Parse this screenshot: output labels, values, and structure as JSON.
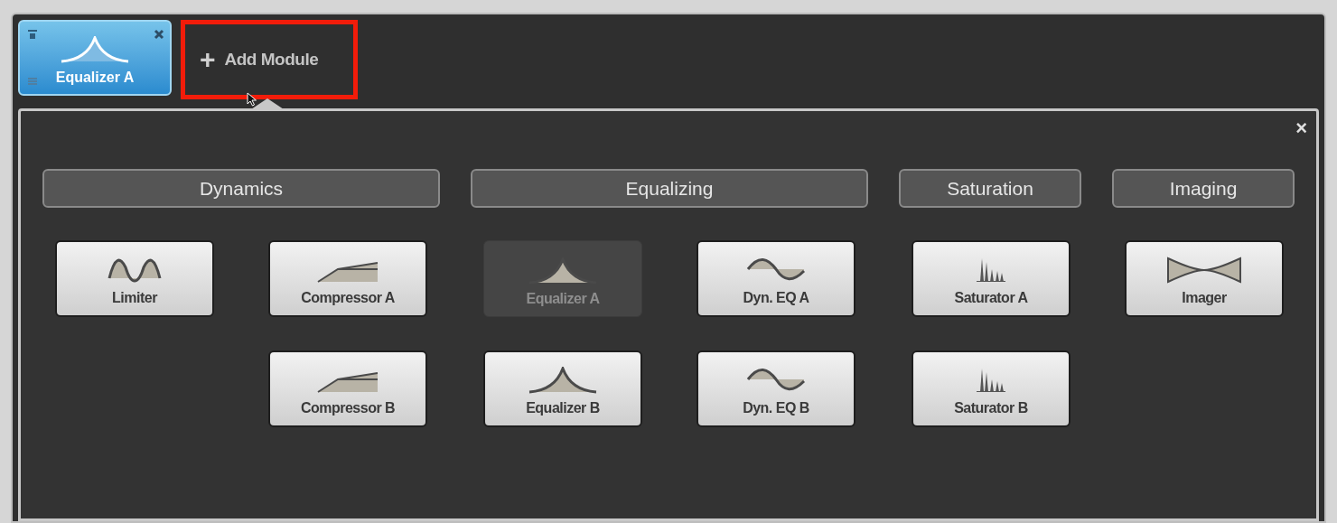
{
  "module_tabs": [
    {
      "label": "Equalizer A",
      "kind": "peak",
      "selected": true
    }
  ],
  "add_module": {
    "label": "Add Module",
    "prefix": "+",
    "highlighted": true
  },
  "panel": {
    "close": "×",
    "categories": [
      {
        "label": "Dynamics",
        "columns": [
          [
            {
              "label": "Limiter",
              "kind": "limiter",
              "disabled": false
            }
          ],
          [
            {
              "label": "Compressor A",
              "kind": "compressor",
              "disabled": false
            },
            {
              "label": "Compressor B",
              "kind": "compressor",
              "disabled": false
            }
          ]
        ]
      },
      {
        "label": "Equalizing",
        "columns": [
          [
            {
              "label": "Equalizer A",
              "kind": "peak",
              "disabled": true
            },
            {
              "label": "Equalizer B",
              "kind": "peak",
              "disabled": false
            }
          ],
          [
            {
              "label": "Dyn. EQ A",
              "kind": "wave",
              "disabled": false
            },
            {
              "label": "Dyn. EQ B",
              "kind": "wave",
              "disabled": false
            }
          ]
        ]
      },
      {
        "label": "Saturation",
        "columns": [
          [
            {
              "label": "Saturator A",
              "kind": "bars",
              "disabled": false
            },
            {
              "label": "Saturator B",
              "kind": "bars",
              "disabled": false
            }
          ]
        ]
      },
      {
        "label": "Imaging",
        "columns": [
          [
            {
              "label": "Imager",
              "kind": "imager",
              "disabled": false
            }
          ]
        ]
      }
    ]
  }
}
